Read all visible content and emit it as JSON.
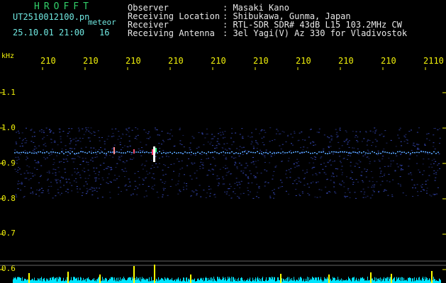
{
  "header": {
    "title": "HROFFT",
    "filename": "UT2510012100.pn",
    "mode": "meteor",
    "datetime": "25.10.01 21:00",
    "count": "16",
    "fields": [
      {
        "label": "Observer",
        "value": ": Masaki Kano"
      },
      {
        "label": "Receiving Location",
        "value": ": Shibukawa, Gunma, Japan"
      },
      {
        "label": "Receiver",
        "value": ": RTL-SDR SDR# 43dB L15 103.2MHz CW"
      },
      {
        "label": "Receiving Antenna",
        "value": ": 3el Yagi(V) Az 330 for Vladivostok"
      }
    ]
  },
  "axis": {
    "y_unit": "kHz",
    "y_ticks": [
      "1.1",
      "1.0",
      "0.9",
      "0.8",
      "0.7",
      "0.6"
    ],
    "x_ticks": [
      "210",
      "210",
      "210",
      "210",
      "210",
      "210",
      "210",
      "210",
      "210",
      "2110"
    ]
  },
  "colors": {
    "background": "#000000",
    "header_title": "#32d06a",
    "header_text": "#6fe7e0",
    "field_text": "#e8e8e8",
    "tick_text": "#f2f20a",
    "noise_band": "#2233aa",
    "meteor_echo": "#ffff00",
    "spectrum_fill": "#00e5ff"
  }
}
